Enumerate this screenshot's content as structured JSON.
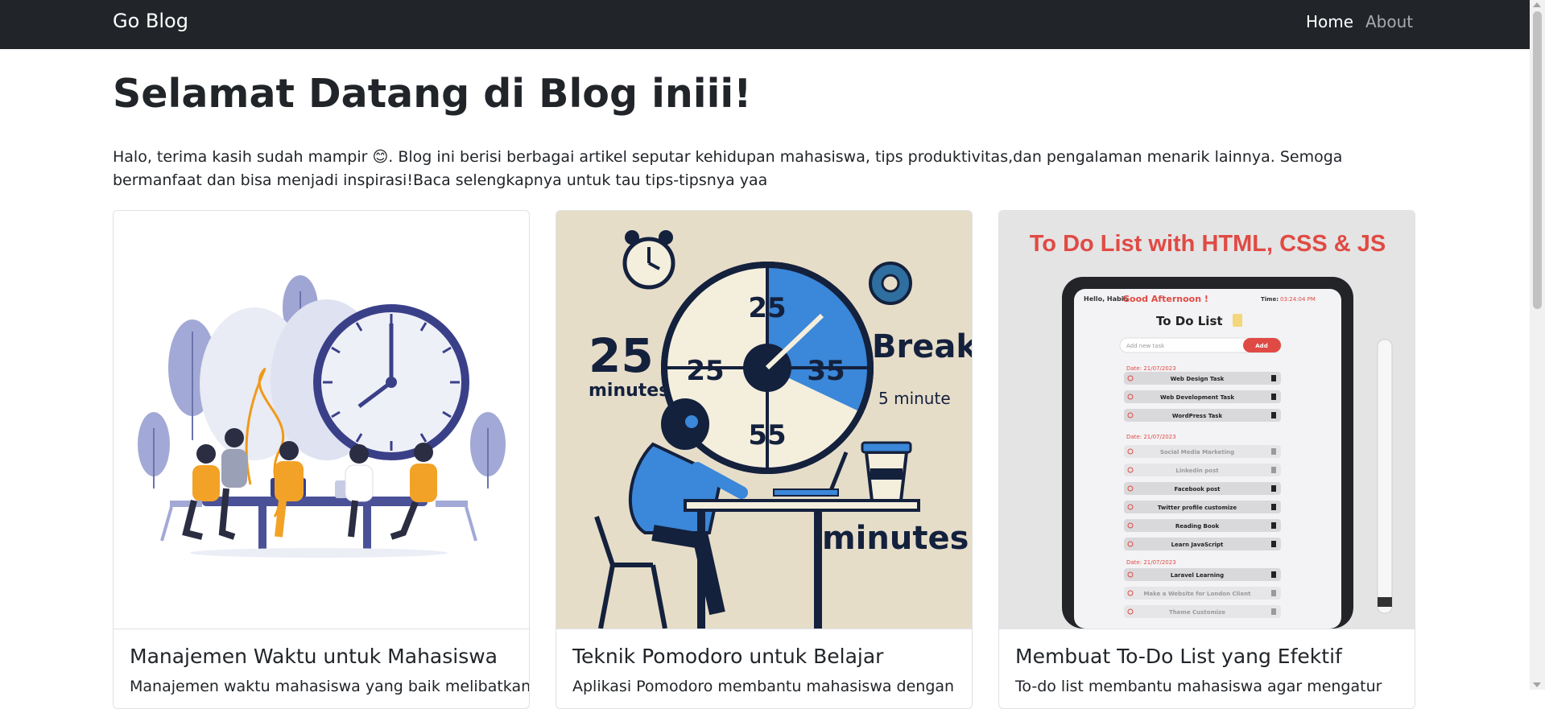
{
  "navbar": {
    "brand": "Go Blog",
    "links": [
      {
        "label": "Home"
      },
      {
        "label": "About"
      }
    ]
  },
  "hero": {
    "title": "Selamat Datang di Blog iniii!",
    "intro": "Halo, terima kasih sudah mampir 😊. Blog ini berisi berbagai artikel seputar kehidupan mahasiswa, tips produktivitas,dan pengalaman menarik lainnya. Semoga bermanfaat dan bisa menjadi inspirasi!Baca selengkapnya untuk tau tips-tipsnya yaa"
  },
  "cards": [
    {
      "title": "Manajemen Waktu untuk Mahasiswa",
      "text": "Manajemen waktu mahasiswa yang baik melibatkan"
    },
    {
      "title": "Teknik Pomodoro untuk Belajar",
      "text": "Aplikasi Pomodoro membantu mahasiswa dengan",
      "image": {
        "left_number": "25",
        "left_unit": "minutes",
        "dial_top": "25",
        "dial_left": "25",
        "dial_right": "35",
        "dial_bottom": "55",
        "break_label": "Break",
        "break_duration": "5 minute",
        "bottom_label": "minutes"
      }
    },
    {
      "title": "Membuat To-Do List yang Efektif",
      "text": "To-do list membantu mahasiswa agar mengatur",
      "image": {
        "heading": "To Do List with HTML, CSS & JS",
        "greeting": "Hello, Habib",
        "salutation": "Good Afternoon !",
        "time_label": "Time:",
        "time_value": "03:24:04 PM",
        "app_title": "To Do List",
        "input_placeholder": "Add new task",
        "add_button": "Add",
        "date_1": "Date: 21/07/2023",
        "date_2": "Date: 21/07/2023",
        "date_3": "Date: 21/07/2023",
        "tasks": [
          {
            "label": "Web Design Task"
          },
          {
            "label": "Web Development Task"
          },
          {
            "label": "WordPress Task"
          },
          {
            "label": "Social Media Marketing"
          },
          {
            "label": "Linkedin post"
          },
          {
            "label": "Facebook post"
          },
          {
            "label": "Twitter profile customize"
          },
          {
            "label": "Reading Book"
          },
          {
            "label": "Learn JavaScript"
          },
          {
            "label": "Laravel Learning"
          },
          {
            "label": "Make a Website for London Client"
          },
          {
            "label": "Theme Customize"
          }
        ]
      }
    }
  ]
}
